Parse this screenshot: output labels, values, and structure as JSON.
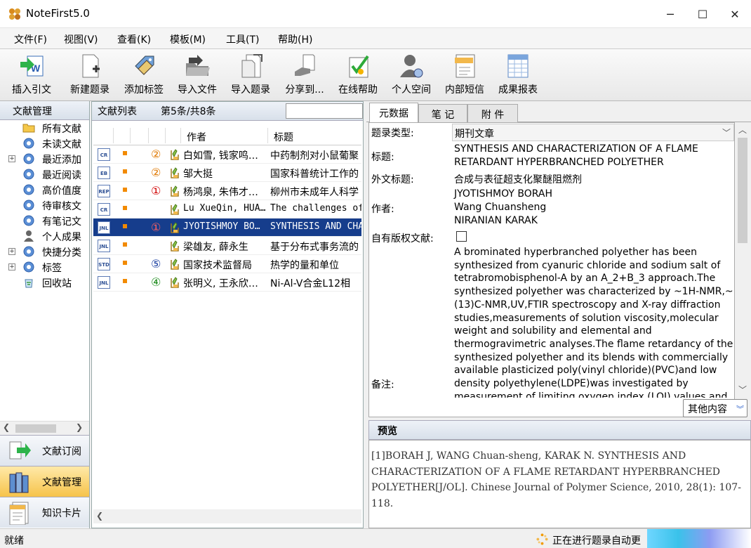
{
  "window": {
    "title": "NoteFirst5.0",
    "min": "─",
    "max": "☐",
    "close": "✕"
  },
  "menu": [
    "文件(F)",
    "视图(V)",
    "查看(K)",
    "模板(M)",
    "工具(T)",
    "帮助(H)"
  ],
  "toolbar": [
    {
      "label": "插入引文",
      "icon": "insert-citation-icon"
    },
    {
      "label": "新建题录",
      "icon": "new-record-icon"
    },
    {
      "label": "添加标签",
      "icon": "add-tag-icon"
    },
    {
      "label": "导入文件",
      "icon": "import-file-icon"
    },
    {
      "label": "导入题录",
      "icon": "import-record-icon"
    },
    {
      "label": "分享到...",
      "icon": "share-icon"
    },
    {
      "label": "在线帮助",
      "icon": "online-help-icon"
    },
    {
      "label": "个人空间",
      "icon": "personal-space-icon"
    },
    {
      "label": "内部短信",
      "icon": "internal-message-icon"
    },
    {
      "label": "成果报表",
      "icon": "report-icon"
    }
  ],
  "left": {
    "header": "文献管理",
    "tree": [
      {
        "label": "所有文献",
        "icon": "folder-icon",
        "expand": false
      },
      {
        "label": "未读文献",
        "icon": "search-folder-icon",
        "expand": false
      },
      {
        "label": "最近添加",
        "icon": "search-folder-icon",
        "expand": true
      },
      {
        "label": "最近阅读",
        "icon": "search-folder-icon",
        "expand": false
      },
      {
        "label": "高价值度",
        "icon": "search-folder-icon",
        "expand": false
      },
      {
        "label": "待审核文",
        "icon": "search-folder-icon",
        "expand": false
      },
      {
        "label": "有笔记文",
        "icon": "search-folder-icon",
        "expand": false
      },
      {
        "label": "个人成果",
        "icon": "person-icon",
        "expand": false
      },
      {
        "label": "快捷分类",
        "icon": "search-folder-icon",
        "expand": true
      },
      {
        "label": "标签",
        "icon": "search-folder-icon",
        "expand": true
      },
      {
        "label": "回收站",
        "icon": "recycle-bin-icon",
        "expand": false
      }
    ],
    "nav": [
      {
        "label": "文献订阅",
        "icon": "subscription-icon",
        "active": false
      },
      {
        "label": "文献管理",
        "icon": "library-icon",
        "active": true
      },
      {
        "label": "知识卡片",
        "icon": "knowledge-card-icon",
        "active": false
      }
    ]
  },
  "list": {
    "header": "文献列表",
    "count": "第5条/共8条",
    "col_author": "作者",
    "col_title": "标题",
    "rows": [
      {
        "type": "CR",
        "circ": "②",
        "circ_color": "#e07800",
        "author": "白如雪, 钱家鸣…",
        "title": "中药制剂对小鼠葡聚",
        "mono": false,
        "sel": false
      },
      {
        "type": "EB",
        "circ": "②",
        "circ_color": "#e07800",
        "author": "邹大挺",
        "title": "国家科普统计工作的",
        "mono": false,
        "sel": false
      },
      {
        "type": "REP",
        "circ": "①",
        "circ_color": "#d00000",
        "author": "杨鸿泉, 朱伟才…",
        "title": "柳州市未成年人科学",
        "mono": false,
        "sel": false
      },
      {
        "type": "CR",
        "circ": "",
        "circ_color": "",
        "author": "Lu XueQin, HUA…",
        "title": "The challenges of",
        "mono": true,
        "sel": false
      },
      {
        "type": "JNL",
        "circ": "①",
        "circ_color": "#d00000",
        "author": "JYOTISHMOY BO…",
        "title": "SYNTHESIS AND CHA",
        "mono": true,
        "sel": true
      },
      {
        "type": "JNL",
        "circ": "",
        "circ_color": "",
        "author": "梁雄友, 薛永生",
        "title": "基于分布式事务流的",
        "mono": false,
        "sel": false
      },
      {
        "type": "STD",
        "circ": "⑤",
        "circ_color": "#1a3fa0",
        "author": "国家技术监督局",
        "title": "热学的量和单位",
        "mono": false,
        "sel": false
      },
      {
        "type": "JNL",
        "circ": "④",
        "circ_color": "#1a8a1a",
        "author": "张明义, 王永欣…",
        "title": "Ni-Al-V合金L12相",
        "mono": false,
        "sel": false
      }
    ]
  },
  "tabs": [
    "元数据",
    "笔 记",
    "附 件"
  ],
  "meta": {
    "type_label": "题录类型:",
    "type_value": "期刊文章",
    "title_label": "标题:",
    "title_value_1": "SYNTHESIS AND CHARACTERIZATION OF A FLAME",
    "title_value_2": "RETARDANT HYPERBRANCHED POLYETHER",
    "foreign_label": "外文标题:",
    "foreign_value": "合成与表征超支化聚醚阻燃剂",
    "author_label": "作者:",
    "authors": [
      "JYOTISHMOY BORAH",
      "Wang Chuansheng",
      "NIRANIAN KARAK"
    ],
    "copyright_label": "自有版权文献:",
    "notes_label": "备注:",
    "abstract": "A brominated hyperbranched polyether has been synthesized from cyanuric chloride and sodium salt of tetrabromobisphenol-A by an A_2+B_3 approach.The synthesized polyether was characterized by ~1H-NMR,~(13)C-NMR,UV,FTIR spectroscopy and X-ray diffraction studies,measurements of solution viscosity,molecular weight and solubility and elemental and thermogravimetric analyses.The flame retardancy of the synthesized polyether and its blends with commercially available plasticized poly(vinyl chloride)(PVC)and low density polyethylene(LDPE)was investigated by measurement of limiting oxygen index (LOI) values and",
    "more_button": "其他内容"
  },
  "preview": {
    "header": "预览",
    "text": "[1]BORAH J, WANG Chuan-sheng, KARAK N. SYNTHESIS AND CHARACTERIZATION OF A FLAME RETARDANT HYPERBRANCHED POLYETHER[J/OL]. Chinese Journal of Polymer Science, 2010, 28(1): 107-118."
  },
  "status": {
    "left": "就绪",
    "right": "正在进行题录自动更"
  }
}
